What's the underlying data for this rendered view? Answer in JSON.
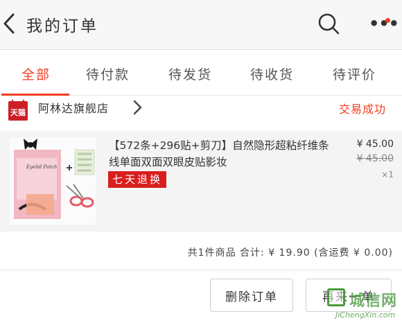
{
  "colors": {
    "accent": "#f23c1e",
    "red_badge": "#d91e1e",
    "brand_tmall": "#cc1f26"
  },
  "header": {
    "title": "我的订单",
    "back_icon": "chevron-left-icon",
    "search_icon": "search-icon",
    "more_icon": "more-dots-icon"
  },
  "tabs": [
    {
      "label": "全部",
      "active": true
    },
    {
      "label": "待付款",
      "active": false
    },
    {
      "label": "待发货",
      "active": false
    },
    {
      "label": "待收货",
      "active": false
    },
    {
      "label": "待评价",
      "active": false
    }
  ],
  "order": {
    "shop": {
      "logo_text": "天猫",
      "name": "阿林达旗舰店",
      "status": "交易成功"
    },
    "item": {
      "title": "【572条+296贴+剪刀】自然隐形超粘纤维条线单面双面双眼皮贴影妆",
      "badge": "七天退换",
      "price": "¥ 45.00",
      "original_price": "¥ 45.00",
      "qty": "×1",
      "image_label": "Eyelid Patch"
    },
    "summary": "共1件商品 合计: ¥ 19.90 (含运费 ¥ 0.00)",
    "actions": {
      "delete_label": "删除订单",
      "buy_again_label": "再来一单"
    }
  },
  "watermark": {
    "cn": "城信网",
    "en": "JiChengXin.com"
  }
}
